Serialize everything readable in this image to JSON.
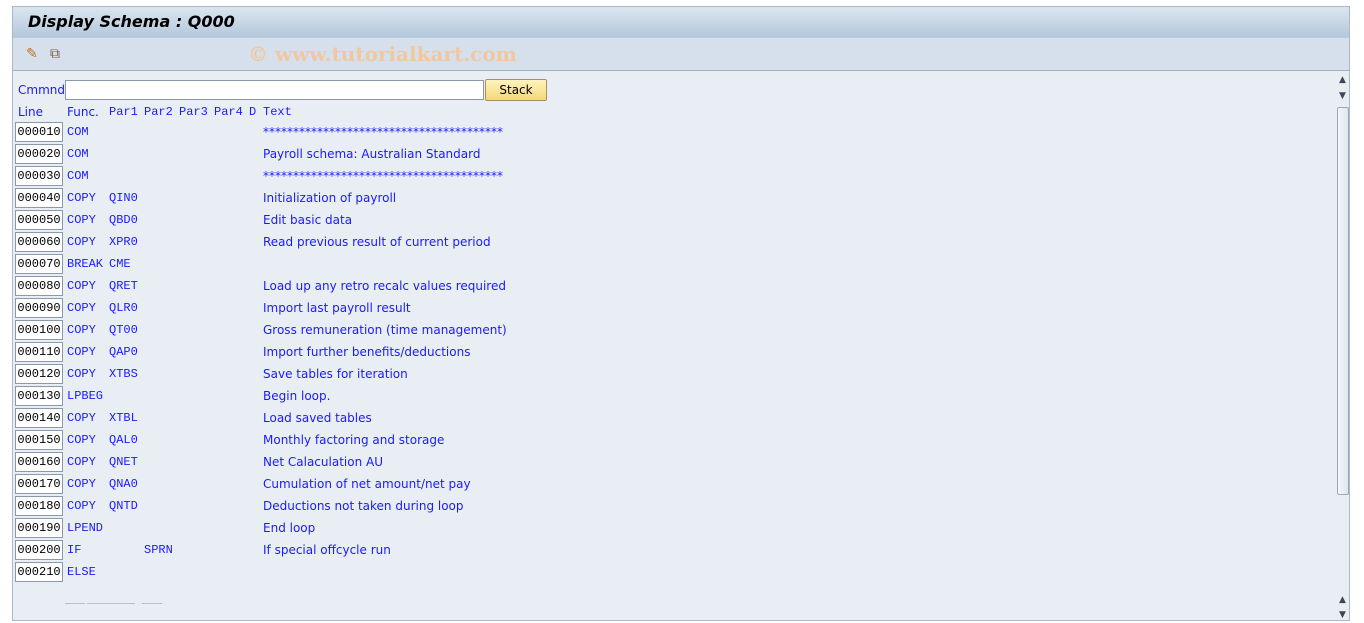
{
  "title": "Display Schema : Q000",
  "toolbar": {
    "icons": [
      "display-change-icon",
      "other-object-icon"
    ],
    "watermark": "© www.tutorialkart.com"
  },
  "command": {
    "label": "Cmmnd",
    "value": "",
    "button": "Stack"
  },
  "headers": {
    "line": "Line",
    "func": "Func.",
    "par1": "Par1",
    "par2": "Par2",
    "par3": "Par3",
    "par4": "Par4",
    "d": "D",
    "text": "Text"
  },
  "rows": [
    {
      "line": "000010",
      "func": "COM",
      "par1": "",
      "par2": "",
      "text": "****************************************"
    },
    {
      "line": "000020",
      "func": "COM",
      "par1": "",
      "par2": "",
      "text": "Payroll schema: Australian Standard"
    },
    {
      "line": "000030",
      "func": "COM",
      "par1": "",
      "par2": "",
      "text": "****************************************"
    },
    {
      "line": "000040",
      "func": "COPY",
      "par1": "QIN0",
      "par2": "",
      "text": "Initialization of payroll"
    },
    {
      "line": "000050",
      "func": "COPY",
      "par1": "QBD0",
      "par2": "",
      "text": "Edit basic data"
    },
    {
      "line": "000060",
      "func": "COPY",
      "par1": "XPR0",
      "par2": "",
      "text": "Read previous result of current period"
    },
    {
      "line": "000070",
      "func": "BREAK",
      "par1": "CME",
      "par2": "",
      "text": ""
    },
    {
      "line": "000080",
      "func": "COPY",
      "par1": "QRET",
      "par2": "",
      "text": "Load up any retro recalc values required"
    },
    {
      "line": "000090",
      "func": "COPY",
      "par1": "QLR0",
      "par2": "",
      "text": "Import last payroll result"
    },
    {
      "line": "000100",
      "func": "COPY",
      "par1": "QT00",
      "par2": "",
      "text": "Gross remuneration (time management)"
    },
    {
      "line": "000110",
      "func": "COPY",
      "par1": "QAP0",
      "par2": "",
      "text": "Import further benefits/deductions"
    },
    {
      "line": "000120",
      "func": "COPY",
      "par1": "XTBS",
      "par2": "",
      "text": "Save tables for iteration"
    },
    {
      "line": "000130",
      "func": "LPBEG",
      "par1": "",
      "par2": "",
      "text": "Begin loop."
    },
    {
      "line": "000140",
      "func": "COPY",
      "par1": "XTBL",
      "par2": "",
      "text": "Load saved tables"
    },
    {
      "line": "000150",
      "func": "COPY",
      "par1": "QAL0",
      "par2": "",
      "text": "Monthly factoring and storage"
    },
    {
      "line": "000160",
      "func": "COPY",
      "par1": "QNET",
      "par2": "",
      "text": "Net Calaculation AU"
    },
    {
      "line": "000170",
      "func": "COPY",
      "par1": "QNA0",
      "par2": "",
      "text": "Cumulation of net amount/net pay"
    },
    {
      "line": "000180",
      "func": "COPY",
      "par1": "QNTD",
      "par2": "",
      "text": "Deductions not taken during loop"
    },
    {
      "line": "000190",
      "func": "LPEND",
      "par1": "",
      "par2": "",
      "text": "End loop"
    },
    {
      "line": "000200",
      "func": "IF",
      "par1": "",
      "par2": "SPRN",
      "text": "If special offcycle run"
    },
    {
      "line": "000210",
      "func": "ELSE",
      "par1": "",
      "par2": "",
      "text": ""
    }
  ]
}
